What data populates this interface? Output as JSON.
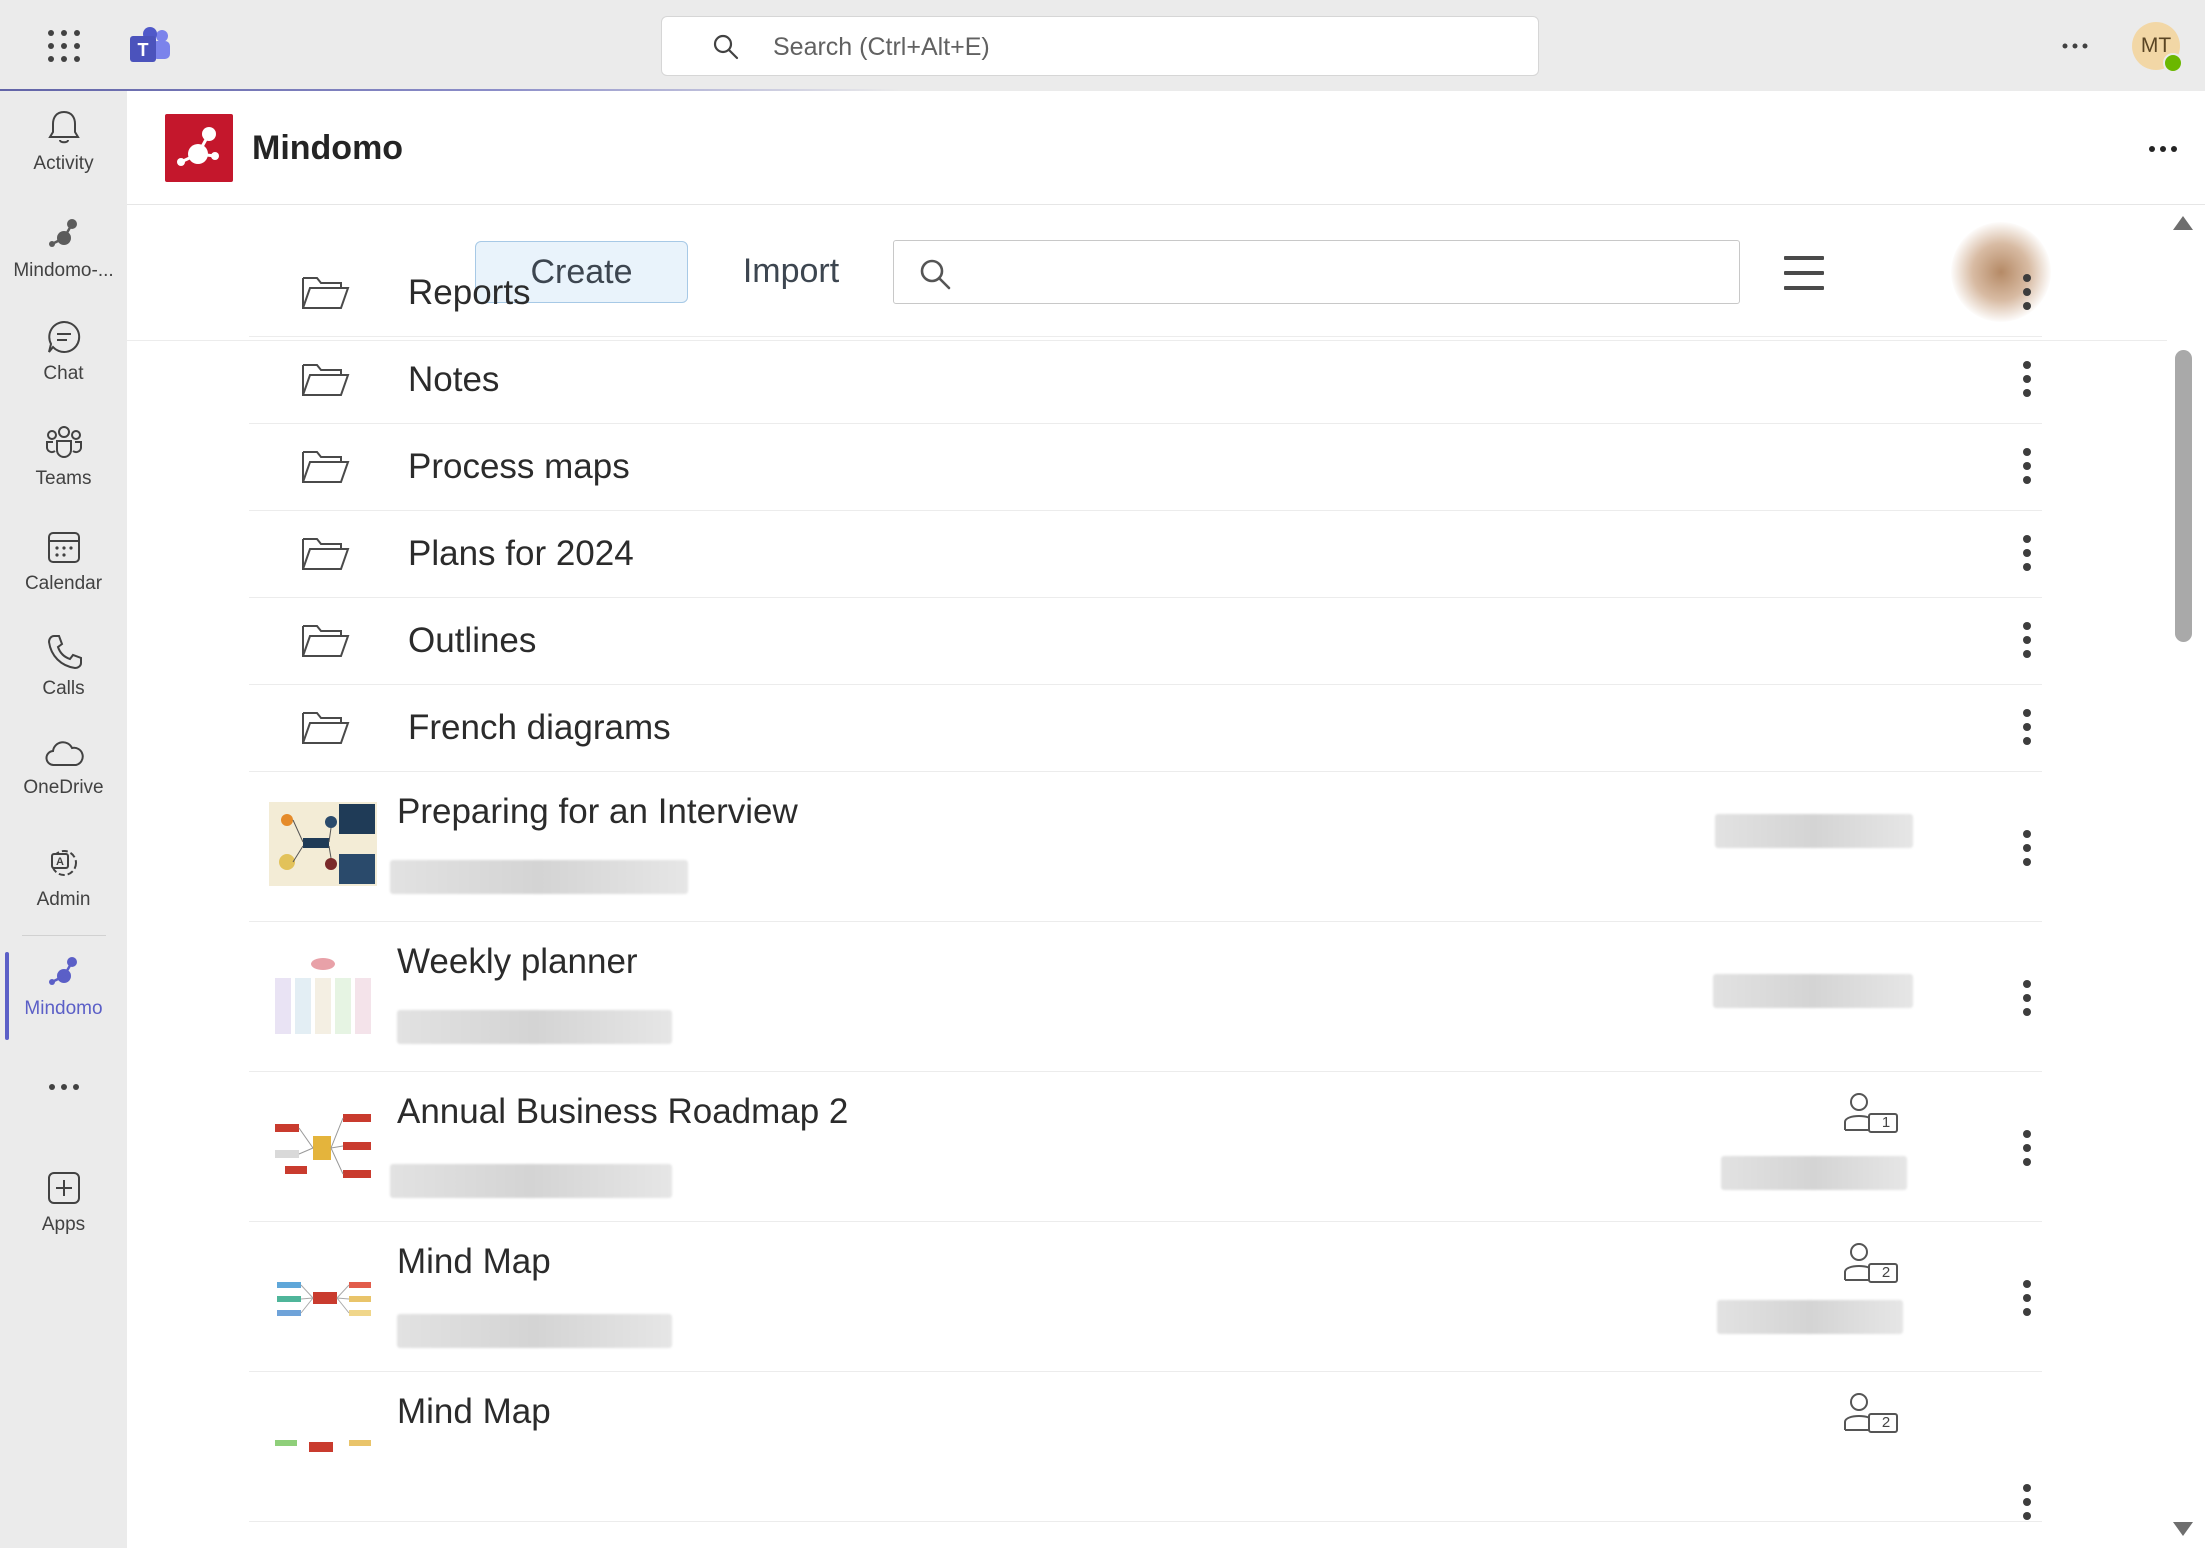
{
  "topbar": {
    "search_placeholder": "Search (Ctrl+Alt+E)",
    "avatar_initials": "MT"
  },
  "rail": {
    "items": [
      {
        "label": "Activity",
        "icon": "bell-icon"
      },
      {
        "label": "Mindomo-...",
        "icon": "mindomo-icon"
      },
      {
        "label": "Chat",
        "icon": "chat-icon"
      },
      {
        "label": "Teams",
        "icon": "teams-icon"
      },
      {
        "label": "Calendar",
        "icon": "calendar-icon"
      },
      {
        "label": "Calls",
        "icon": "phone-icon"
      },
      {
        "label": "OneDrive",
        "icon": "cloud-icon"
      },
      {
        "label": "Admin",
        "icon": "admin-icon"
      },
      {
        "label": "Mindomo",
        "icon": "mindomo-icon"
      },
      {
        "label": "Apps",
        "icon": "apps-icon"
      }
    ],
    "active": "Mindomo"
  },
  "app": {
    "title": "Mindomo",
    "brand_color": "#c4172c"
  },
  "toolbar": {
    "create_label": "Create",
    "import_label": "Import"
  },
  "folders": [
    {
      "name": "Reports"
    },
    {
      "name": "Notes"
    },
    {
      "name": "Process maps"
    },
    {
      "name": "Plans for 2024"
    },
    {
      "name": "Outlines"
    },
    {
      "name": "French diagrams"
    }
  ],
  "maps": [
    {
      "name": "Preparing for an Interview",
      "shared_count": ""
    },
    {
      "name": "Weekly planner",
      "shared_count": ""
    },
    {
      "name": "Annual Business Roadmap 2",
      "shared_count": "1"
    },
    {
      "name": "Mind Map",
      "shared_count": "2"
    },
    {
      "name": "Mind Map",
      "shared_count": "2"
    }
  ],
  "colors": {
    "accent": "#5b5fc7",
    "create_bg": "#e9f3fb"
  }
}
